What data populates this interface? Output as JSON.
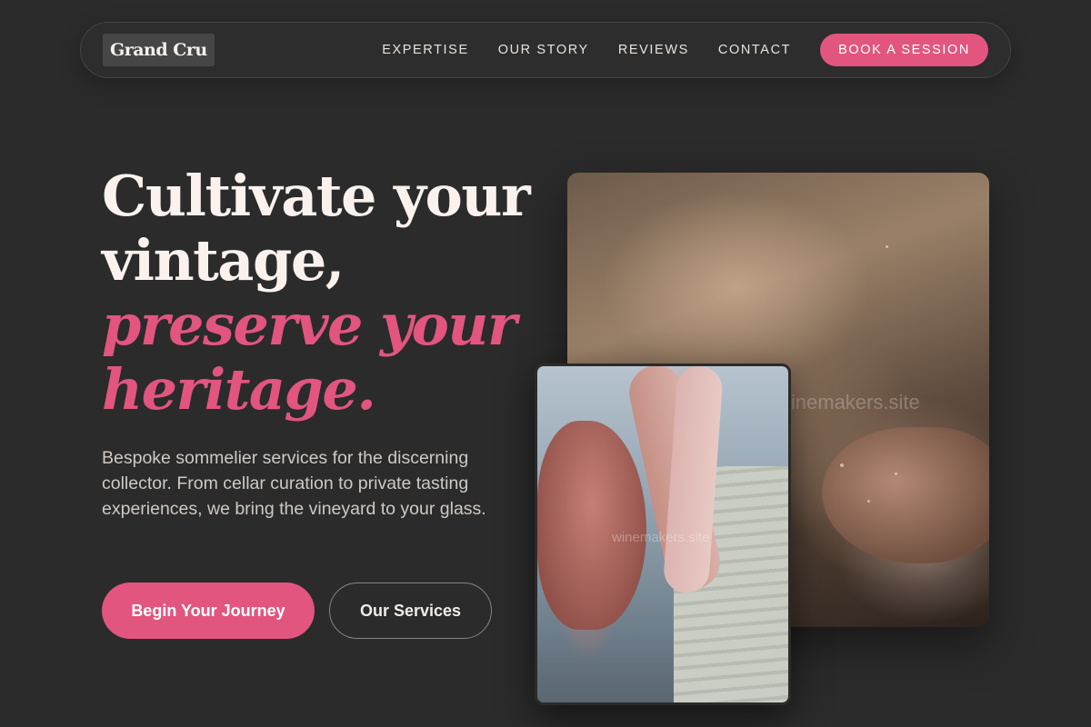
{
  "brand": {
    "logo": "Grand Cru"
  },
  "nav": {
    "links": [
      "EXPERTISE",
      "OUR STORY",
      "REVIEWS",
      "CONTACT"
    ],
    "cta": "BOOK A SESSION"
  },
  "hero": {
    "headline_line1": "Cultivate your",
    "headline_line2": "vintage,",
    "headline_accent1": "preserve your",
    "headline_accent2": "heritage.",
    "description": "Bespoke sommelier services for the discerning collector. From cellar curation to private tasting experiences, we bring the vineyard to your glass.",
    "primary_button": "Begin Your Journey",
    "secondary_button": "Our Services"
  },
  "images": {
    "back_watermark": "winemakers.site",
    "front_watermark": "winemakers.site"
  },
  "colors": {
    "background": "#2b2b2b",
    "accent": "#e2557f",
    "text": "#fbf2ee"
  }
}
